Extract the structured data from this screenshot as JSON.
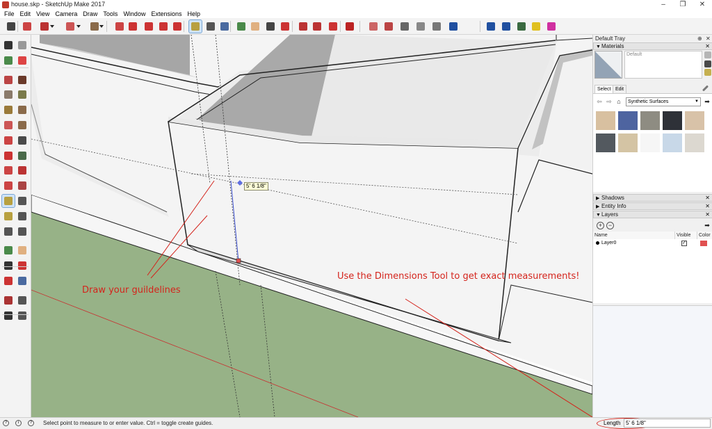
{
  "window": {
    "title": "house.skp - SketchUp Make 2017",
    "controls": [
      "–",
      "❐",
      "✕"
    ]
  },
  "menu": [
    "File",
    "Edit",
    "View",
    "Camera",
    "Draw",
    "Tools",
    "Window",
    "Extensions",
    "Help"
  ],
  "toolbar_icons": [
    "select-icon",
    "eraser-icon",
    "pencil-line-icon",
    "dropdown-icon",
    "arc-icon",
    "dropdown-icon",
    "rectangle-icon",
    "dropdown-icon",
    "push-pull-icon",
    "follow-me-icon",
    "move-icon",
    "rotate-icon",
    "scale-icon",
    "tape-measure-icon",
    "text-icon",
    "paint-bucket-icon",
    "orbit-icon",
    "pan-icon",
    "zoom-icon",
    "zoom-extents-icon",
    "warehouse-icon",
    "share-model-icon",
    "components-icon",
    "ruby-icon",
    "section-plane-icon",
    "display-section-icon",
    "display-cuts-icon",
    "xray-icon",
    "back-edges-icon",
    "wireframe-icon",
    "hidden-line-icon",
    "shaded-icon",
    "textured-icon",
    "monochrome-icon",
    "styles-icon"
  ],
  "left_tools": [
    [
      "select-icon",
      "component-icon"
    ],
    [
      "paint-bucket-icon",
      "eraser-icon"
    ],
    [
      "line-icon",
      "freehand-icon"
    ],
    [
      "rectangle-icon",
      "rotated-rectangle-icon"
    ],
    [
      "circle-icon",
      "polygon-icon"
    ],
    [
      "arc-icon",
      "two-point-arc-icon"
    ],
    [
      "three-point-arc-icon",
      "pie-icon"
    ],
    [
      "move-icon",
      "push-pull-icon"
    ],
    [
      "rotate-icon",
      "follow-me-icon"
    ],
    [
      "scale-icon",
      "offset-icon"
    ],
    [
      "tape-measure-icon",
      "dimension-icon"
    ],
    [
      "protractor-icon",
      "text-icon"
    ],
    [
      "axes-icon",
      "3d-text-icon"
    ],
    [
      "orbit-icon",
      "pan-icon"
    ],
    [
      "zoom-icon",
      "zoom-window-icon"
    ],
    [
      "zoom-extents-icon",
      "previous-view-icon"
    ],
    [
      "position-camera-icon",
      "look-around-icon"
    ],
    [
      "walk-icon",
      "section-plane-icon"
    ]
  ],
  "viewport": {
    "measurement_tooltip": "5' 6 1/8\"",
    "annotation_left": "Draw your guildelines",
    "annotation_right": "Use the Dimensions Tool to get exact measurements!"
  },
  "tray": {
    "title": "Default Tray",
    "materials": {
      "header": "Materials",
      "material_name_placeholder": "Default",
      "tab_select": "Select",
      "tab_edit": "Edit",
      "library": "Synthetic Surfaces",
      "swatches": [
        "#d8c0a0",
        "#4e64a0",
        "#8e8c82",
        "#2e3138",
        "#d8c2a8",
        "#53595f",
        "#d4c4a4",
        "#f6f6f6",
        "#c8d8e8",
        "#dcd8d0"
      ]
    },
    "shadows_header": "Shadows",
    "entity_info_header": "Entity Info",
    "layers": {
      "header": "Layers",
      "columns": [
        "Name",
        "Visible",
        "Color"
      ],
      "rows": [
        {
          "name": "Layer0",
          "visible": "✓",
          "color": "#e05050"
        }
      ]
    }
  },
  "status": {
    "message": "Select point to measure to or enter value.  Ctrl = toggle create guides.",
    "vcb_label": "Length",
    "vcb_value": "5' 6 1/8\""
  },
  "colors": {
    "ground": "#97b287",
    "annotation": "#d4241c",
    "shadow": "#a9a9a9",
    "wall": "#f3f3f3"
  }
}
